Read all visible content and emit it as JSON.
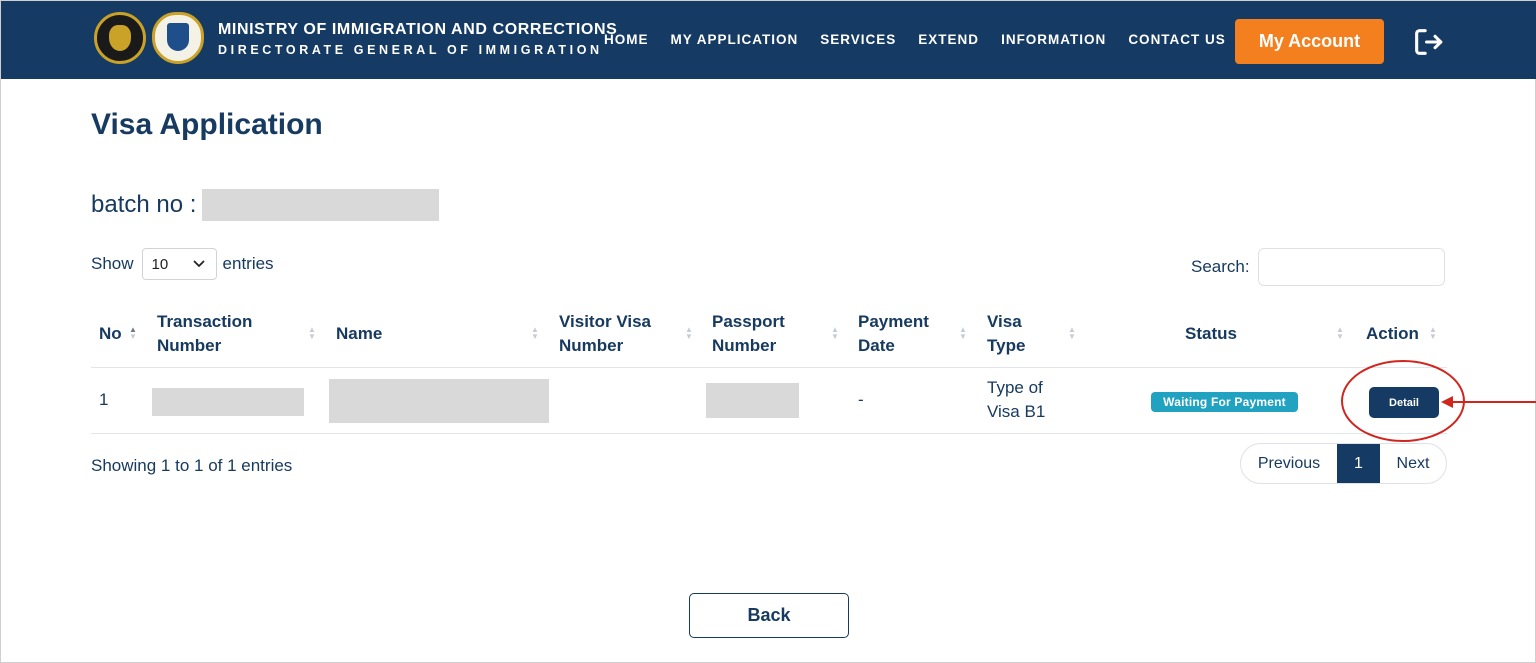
{
  "header": {
    "title_line1": "MINISTRY OF IMMIGRATION AND CORRECTIONS",
    "title_line2": "DIRECTORATE GENERAL OF IMMIGRATION",
    "nav": [
      "HOME",
      "MY APPLICATION",
      "SERVICES",
      "EXTEND",
      "INFORMATION",
      "CONTACT US"
    ],
    "account_button": "My Account",
    "logout_icon": "logout-icon"
  },
  "page": {
    "title": "Visa Application",
    "batch_label": "batch no :"
  },
  "table_controls": {
    "show_label": "Show",
    "entries_label": "entries",
    "page_size": "10",
    "search_label": "Search:"
  },
  "table": {
    "headers": [
      "No",
      "Transaction Number",
      "Name",
      "Visitor Visa Number",
      "Passport Number",
      "Payment Date",
      "Visa Type",
      "Status",
      "Action"
    ],
    "rows": [
      {
        "no": "1",
        "payment_date": "-",
        "visa_type": "Type of Visa B1",
        "status": "Waiting For Payment",
        "action": "Detail"
      }
    ]
  },
  "footer": {
    "showing": "Showing 1 to 1 of 1 entries",
    "previous": "Previous",
    "current_page": "1",
    "next": "Next",
    "back": "Back"
  },
  "colors": {
    "navbar": "#153a63",
    "account_button": "#f37f1f",
    "status_badge": "#21a2c1",
    "annotation": "#d0261e"
  }
}
